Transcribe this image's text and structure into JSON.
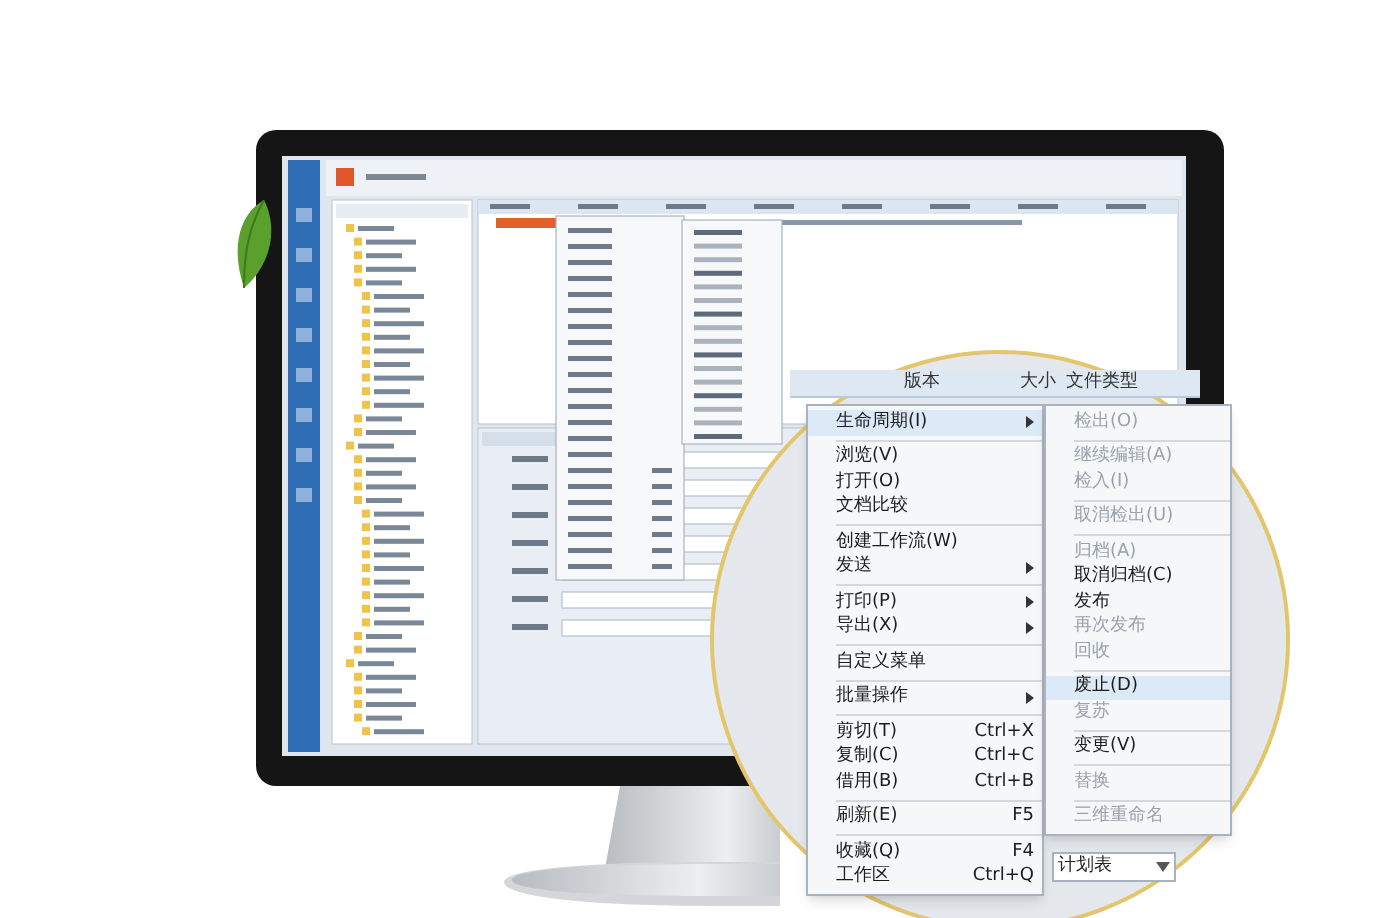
{
  "magnifier": {
    "columns": [
      "版本",
      "大小",
      "文件类型"
    ],
    "menu": [
      {
        "kind": "item",
        "label": "生命周期(I)",
        "submenu": true,
        "selected": true
      },
      {
        "kind": "separator"
      },
      {
        "kind": "item",
        "label": "浏览(V)",
        "submenu": false,
        "selected": false
      },
      {
        "kind": "item",
        "label": "打开(O)",
        "submenu": false,
        "selected": false
      },
      {
        "kind": "item",
        "label": "文档比较",
        "submenu": false,
        "selected": false
      },
      {
        "kind": "separator"
      },
      {
        "kind": "item",
        "label": "创建工作流(W)",
        "submenu": false,
        "selected": false
      },
      {
        "kind": "item",
        "label": "发送",
        "submenu": true,
        "selected": false
      },
      {
        "kind": "separator"
      },
      {
        "kind": "item",
        "label": "打印(P)",
        "submenu": true,
        "selected": false
      },
      {
        "kind": "item",
        "label": "导出(X)",
        "submenu": true,
        "selected": false
      },
      {
        "kind": "separator"
      },
      {
        "kind": "item",
        "label": "自定义菜单",
        "submenu": false,
        "selected": false
      },
      {
        "kind": "separator"
      },
      {
        "kind": "item",
        "label": "批量操作",
        "submenu": true,
        "selected": false
      },
      {
        "kind": "separator"
      },
      {
        "kind": "item",
        "label": "剪切(T)",
        "shortcut": "Ctrl+X",
        "submenu": false,
        "selected": false
      },
      {
        "kind": "item",
        "label": "复制(C)",
        "shortcut": "Ctrl+C",
        "submenu": false,
        "selected": false
      },
      {
        "kind": "item",
        "label": "借用(B)",
        "shortcut": "Ctrl+B",
        "submenu": false,
        "selected": false
      },
      {
        "kind": "separator"
      },
      {
        "kind": "item",
        "label": "刷新(E)",
        "shortcut": "F5",
        "submenu": false,
        "selected": false
      },
      {
        "kind": "separator"
      },
      {
        "kind": "item",
        "label": "收藏(Q)",
        "shortcut": "F4",
        "submenu": false,
        "selected": false
      },
      {
        "kind": "item",
        "label": "工作区",
        "shortcut": "Ctrl+Q",
        "submenu": false,
        "selected": false
      }
    ],
    "submenu": [
      {
        "kind": "item",
        "label": "检出(O)",
        "disabled": true,
        "selected": false
      },
      {
        "kind": "separator"
      },
      {
        "kind": "item",
        "label": "继续编辑(A)",
        "disabled": true,
        "selected": false
      },
      {
        "kind": "item",
        "label": "检入(I)",
        "disabled": true,
        "selected": false
      },
      {
        "kind": "separator"
      },
      {
        "kind": "item",
        "label": "取消检出(U)",
        "disabled": true,
        "selected": false
      },
      {
        "kind": "separator"
      },
      {
        "kind": "item",
        "label": "归档(A)",
        "disabled": true,
        "selected": false
      },
      {
        "kind": "item",
        "label": "取消归档(C)",
        "disabled": false,
        "selected": false
      },
      {
        "kind": "item",
        "label": "发布",
        "disabled": false,
        "selected": false
      },
      {
        "kind": "item",
        "label": "再次发布",
        "disabled": true,
        "selected": false
      },
      {
        "kind": "item",
        "label": "回收",
        "disabled": true,
        "selected": false
      },
      {
        "kind": "separator"
      },
      {
        "kind": "item",
        "label": "废止(D)",
        "disabled": false,
        "selected": true
      },
      {
        "kind": "item",
        "label": "复苏",
        "disabled": true,
        "selected": false
      },
      {
        "kind": "separator"
      },
      {
        "kind": "item",
        "label": "变更(V)",
        "disabled": false,
        "selected": false
      },
      {
        "kind": "separator"
      },
      {
        "kind": "item",
        "label": "替换",
        "disabled": true,
        "selected": false
      },
      {
        "kind": "separator"
      },
      {
        "kind": "item",
        "label": "三维重命名",
        "disabled": true,
        "selected": false
      }
    ],
    "field": {
      "value": "计划表"
    }
  }
}
